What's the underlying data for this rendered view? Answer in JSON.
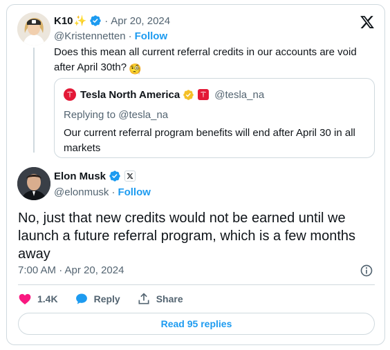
{
  "parent_tweet": {
    "name": "K10",
    "name_emoji": "✨",
    "handle": "@Kristennetten",
    "date": "Apr 20, 2024",
    "follow_label": "Follow",
    "text": "Does this mean all current referral credits in our accounts are void after April 30th?",
    "text_emoji": "🧐"
  },
  "quoted_tweet": {
    "name": "Tesla North America",
    "handle": "@tesla_na",
    "replying_to": "Replying to @tesla_na",
    "text": "Our current referral program benefits will end after April 30 in all markets"
  },
  "main_tweet": {
    "name": "Elon Musk",
    "handle": "@elonmusk",
    "follow_label": "Follow",
    "text": "No, just that new credits would not be earned until we launch a future referral program, which is a few months away",
    "timestamp": "7:00 AM · Apr 20, 2024",
    "likes": "1.4K",
    "reply_label": "Reply",
    "share_label": "Share",
    "read_replies_label": "Read 95 replies"
  },
  "icons": {
    "brand": "x-logo-icon",
    "verified": "verified-badge-icon",
    "like": "heart-icon",
    "reply": "speech-bubble-icon",
    "share": "share-icon",
    "info": "info-icon"
  },
  "colors": {
    "accent": "#1d9bf0",
    "like": "#f91880",
    "muted": "#536471",
    "tesla_red": "#e31937",
    "gold": "#f4c028",
    "border": "#cfd9de"
  }
}
